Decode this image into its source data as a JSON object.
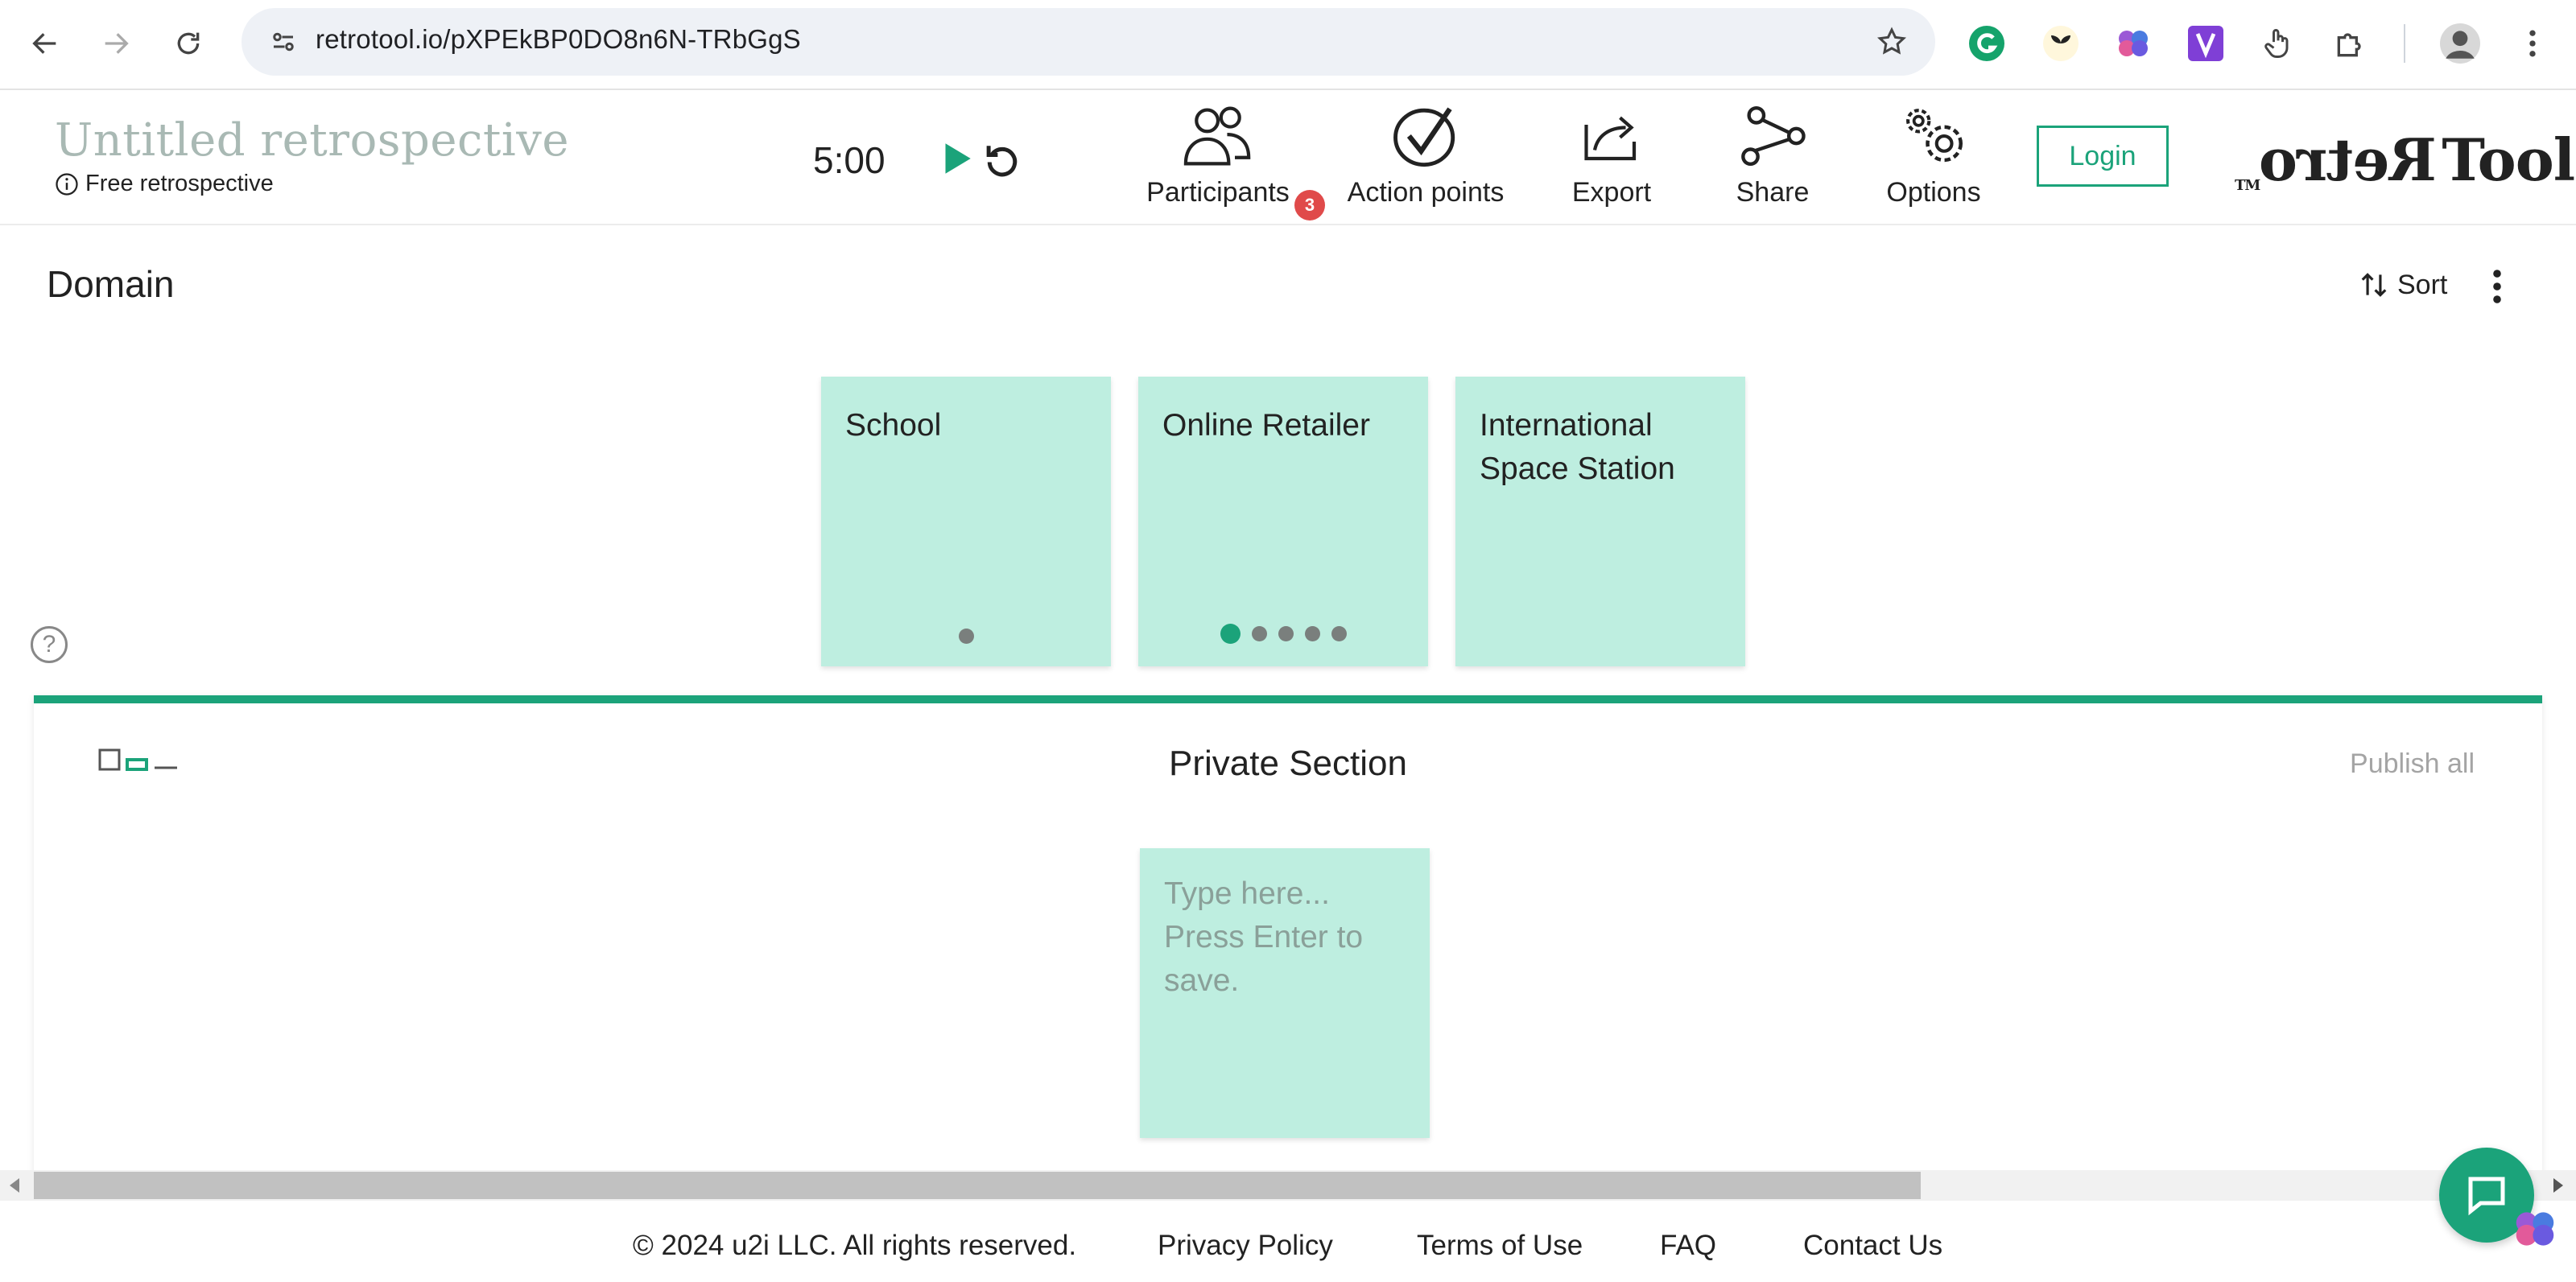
{
  "browser": {
    "url": "retrotool.io/pXPEkBP0DO8n6N-TRbGgS",
    "extensions": [
      "grammarly-icon",
      "sprout-icon",
      "brain-icon",
      "v-icon",
      "hand-pointer-icon",
      "puzzle-icon",
      "profile-avatar"
    ]
  },
  "header": {
    "title": "Untitled retrospective",
    "subtitle": "Free retrospective",
    "timer": "5:00",
    "tools": {
      "participants": "Participants",
      "participants_count": "3",
      "action_points": "Action points",
      "export": "Export",
      "share": "Share",
      "options": "Options"
    },
    "login": "Login",
    "logo_a": "Retro",
    "logo_b": "Tool",
    "logo_tm": "TM"
  },
  "board": {
    "column_title": "Domain",
    "sort_label": "Sort",
    "cards": [
      {
        "text": "School",
        "dots": 1,
        "active_dot": -1
      },
      {
        "text": "Online Retailer",
        "dots": 5,
        "active_dot": 0
      },
      {
        "text": "International Space Station",
        "dots": 0,
        "active_dot": -1
      }
    ]
  },
  "private_section": {
    "title": "Private Section",
    "publish_all": "Publish all",
    "draft_placeholder": "Type here... Press Enter to save."
  },
  "footer": {
    "copyright": "© 2024  u2i LLC. All rights reserved.",
    "privacy": "Privacy Policy",
    "terms": "Terms of Use",
    "faq": "FAQ",
    "contact": "Contact Us"
  },
  "colors": {
    "accent": "#1ba37a",
    "card": "#beeee0",
    "badge": "#e04a4a"
  }
}
